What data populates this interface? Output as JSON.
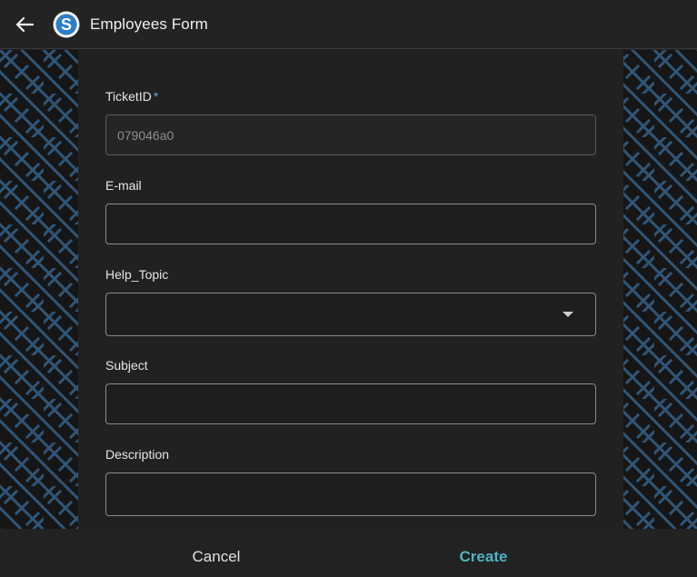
{
  "header": {
    "title": "Employees Form",
    "logo_letter": "S"
  },
  "form": {
    "ticket_id": {
      "label": "TicketID",
      "required_mark": "*",
      "value": "079046a0"
    },
    "email": {
      "label": "E-mail",
      "value": ""
    },
    "help_topic": {
      "label": "Help_Topic",
      "selected": ""
    },
    "subject": {
      "label": "Subject",
      "value": ""
    },
    "description": {
      "label": "Description",
      "value": ""
    }
  },
  "footer": {
    "cancel_label": "Cancel",
    "create_label": "Create"
  },
  "colors": {
    "accent": "#4fb3c4",
    "background": "#1f1f1f",
    "pattern": "#2f5678"
  }
}
